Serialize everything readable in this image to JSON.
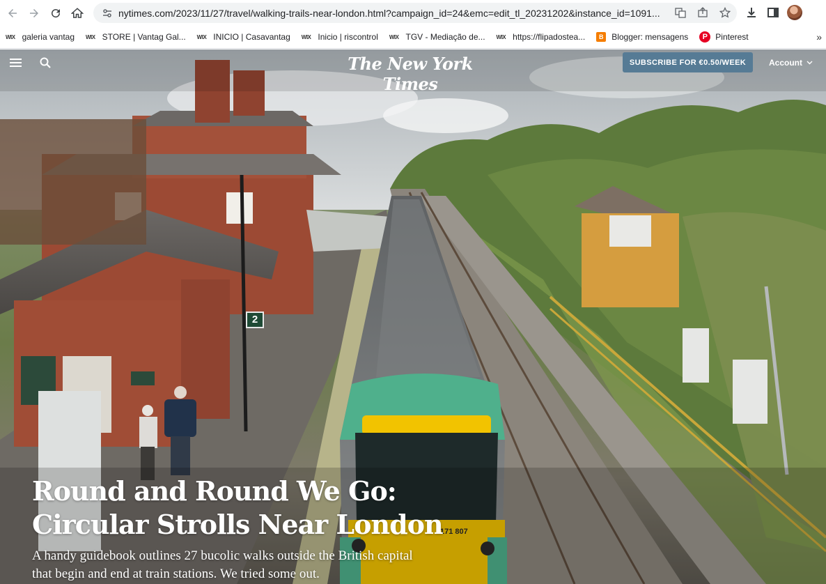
{
  "browser": {
    "url": "nytimes.com/2023/11/27/travel/walking-trails-near-london.html?campaign_id=24&emc=edit_tl_20231202&instance_id=1091...",
    "bookmarks": [
      {
        "icon": "wix",
        "label": "galeria vantag"
      },
      {
        "icon": "wix",
        "label": "STORE | Vantag Gal..."
      },
      {
        "icon": "wix",
        "label": "INICIO | Casavantag"
      },
      {
        "icon": "wix",
        "label": "Inicio | riscontrol"
      },
      {
        "icon": "wix",
        "label": "TGV - Mediação de..."
      },
      {
        "icon": "wix",
        "label": "https://flipadostea..."
      },
      {
        "icon": "blogger",
        "label": "Blogger: mensagens"
      },
      {
        "icon": "pinterest",
        "label": "Pinterest"
      }
    ],
    "more": "»"
  },
  "site": {
    "logo": "The New York Times",
    "subscribe_label": "SUBSCRIBE FOR €0.50/WEEK",
    "account_label": "Account"
  },
  "article": {
    "headline_line1": "Round and Round We Go:",
    "headline_line2": "Circular Strolls Near London",
    "dek_line1": "A handy guidebook outlines 27 bucolic walks outside the British capital",
    "dek_line2": "that begin and end at train stations. We tried some out."
  },
  "photo": {
    "platform_number": "2",
    "train_number": "171 807"
  },
  "colors": {
    "subscribe_bg": "#567b95",
    "train_green": "#4fb08c",
    "train_yellow": "#f2c300"
  }
}
